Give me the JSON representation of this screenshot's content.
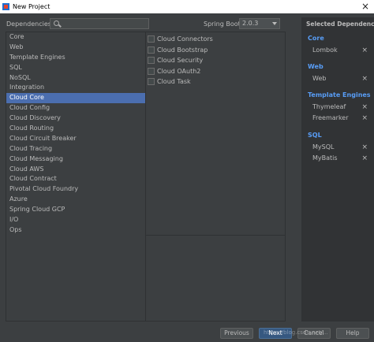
{
  "window": {
    "title": "New Project",
    "close_glyph": "×"
  },
  "header": {
    "dependencies_label": "Dependencies",
    "search_value": "",
    "spring_boot_label": "Spring Boot",
    "spring_boot_version": "2.0.3"
  },
  "categories": [
    "Core",
    "Web",
    "Template Engines",
    "SQL",
    "NoSQL",
    "Integration",
    "Cloud Core",
    "Cloud Config",
    "Cloud Discovery",
    "Cloud Routing",
    "Cloud Circuit Breaker",
    "Cloud Tracing",
    "Cloud Messaging",
    "Cloud AWS",
    "Cloud Contract",
    "Pivotal Cloud Foundry",
    "Azure",
    "Spring Cloud GCP",
    "I/O",
    "Ops"
  ],
  "selected_category": "Cloud Core",
  "options": [
    {
      "label": "Cloud Connectors",
      "checked": false
    },
    {
      "label": "Cloud Bootstrap",
      "checked": false
    },
    {
      "label": "Cloud Security",
      "checked": false
    },
    {
      "label": "Cloud OAuth2",
      "checked": false
    },
    {
      "label": "Cloud Task",
      "checked": false
    }
  ],
  "selected": {
    "title": "Selected Dependencies",
    "groups": [
      {
        "name": "Core",
        "items": [
          "Lombok"
        ]
      },
      {
        "name": "Web",
        "items": [
          "Web"
        ]
      },
      {
        "name": "Template Engines",
        "items": [
          "Thymeleaf",
          "Freemarker"
        ]
      },
      {
        "name": "SQL",
        "items": [
          "MySQL",
          "MyBatis"
        ]
      }
    ],
    "remove_glyph": "×"
  },
  "footer": {
    "previous": "Previous",
    "next": "Next",
    "cancel": "Cancel",
    "help": "Help",
    "watermark": "https://blog.csdn.net/..."
  },
  "colors": {
    "accent": "#4b6eaf",
    "group_title": "#589df6",
    "background": "#3c3f41"
  }
}
